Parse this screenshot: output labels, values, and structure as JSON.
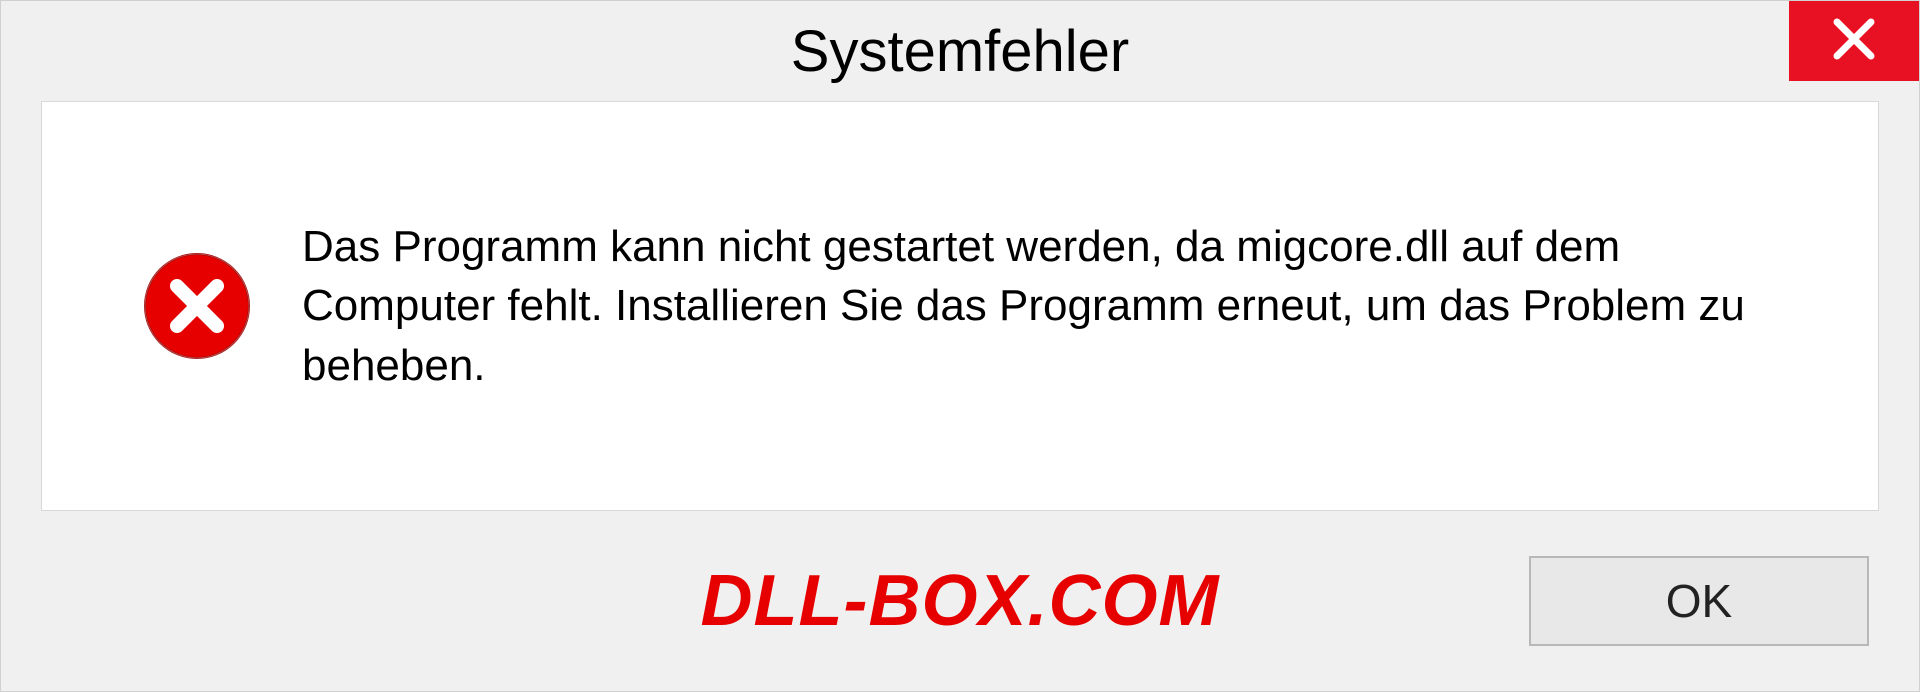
{
  "dialog": {
    "title": "Systemfehler",
    "message": "Das Programm kann nicht gestartet werden, da migcore.dll auf dem Computer fehlt. Installieren Sie das Programm erneut, um das Problem zu beheben.",
    "ok_label": "OK"
  },
  "watermark": "DLL-BOX.COM"
}
